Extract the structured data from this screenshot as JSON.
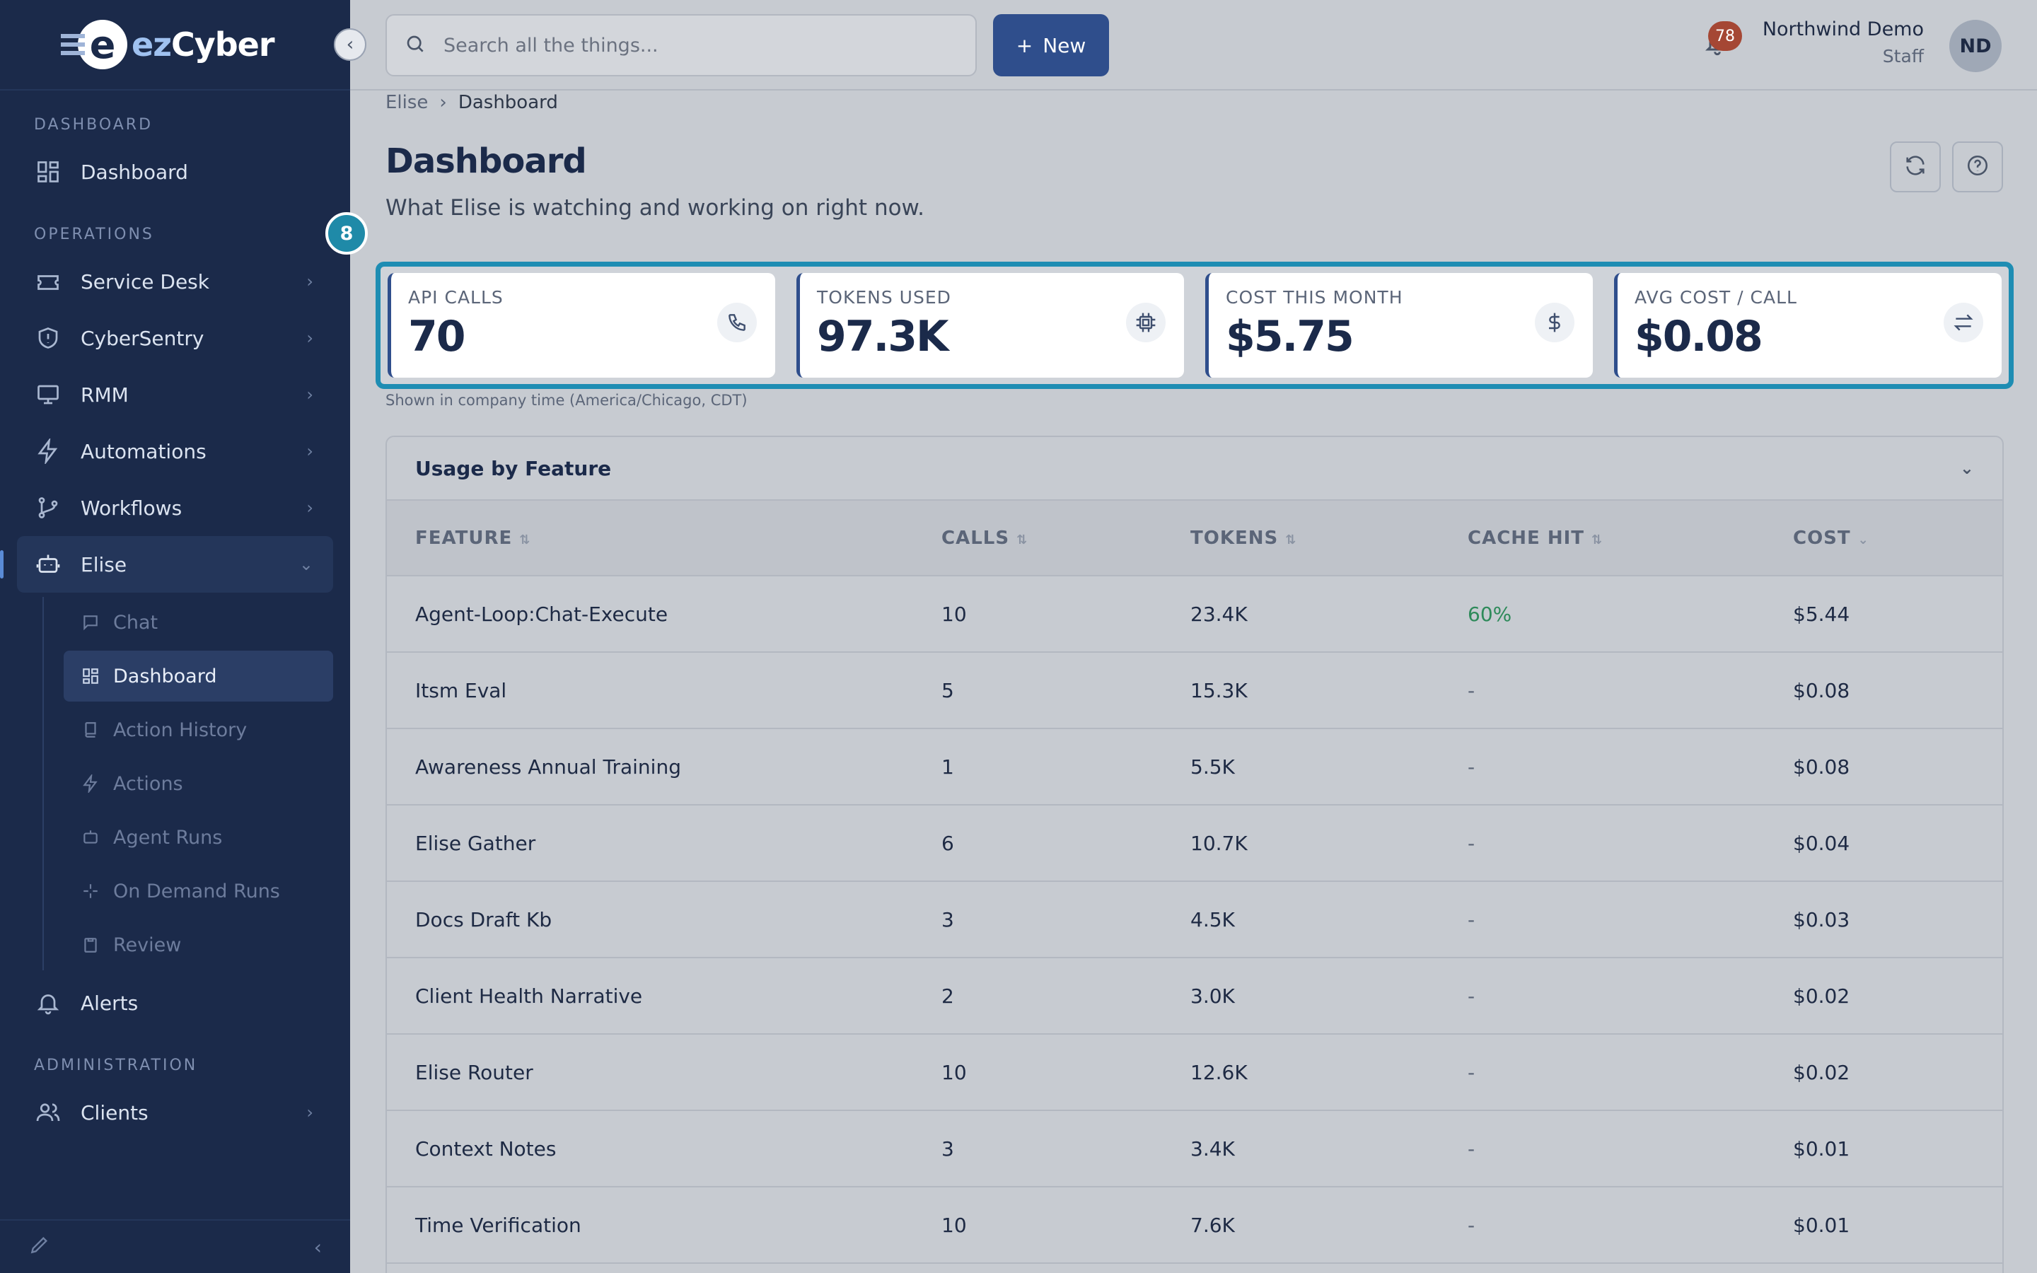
{
  "brand": {
    "logo_e": "e",
    "logo_ez": "ez",
    "logo_cyber": "Cyber"
  },
  "sidebar": {
    "sections": {
      "dashboard": "DASHBOARD",
      "operations": "OPERATIONS",
      "administration": "ADMINISTRATION"
    },
    "items": {
      "dashboard": "Dashboard",
      "service_desk": "Service Desk",
      "cybersentry": "CyberSentry",
      "rmm": "RMM",
      "automations": "Automations",
      "workflows": "Workflows",
      "elise": "Elise",
      "alerts": "Alerts",
      "clients": "Clients"
    },
    "elise_sub": {
      "chat": "Chat",
      "dashboard": "Dashboard",
      "action_history": "Action History",
      "actions": "Actions",
      "agent_runs": "Agent Runs",
      "on_demand_runs": "On Demand Runs",
      "review": "Review"
    }
  },
  "topbar": {
    "search_placeholder": "Search all the things...",
    "new_label": "New",
    "notification_count": "78",
    "user_name": "Northwind Demo",
    "user_role": "Staff",
    "avatar_initials": "ND"
  },
  "breadcrumb": {
    "root": "Elise",
    "current": "Dashboard"
  },
  "page": {
    "title": "Dashboard",
    "subtitle": "What Elise is watching and working on right now.",
    "step_number": "8",
    "tz_note": "Shown in company time (America/Chicago, CDT)"
  },
  "stats": [
    {
      "label": "API CALLS",
      "value": "70",
      "icon": "phone-icon"
    },
    {
      "label": "TOKENS USED",
      "value": "97.3K",
      "icon": "chip-icon"
    },
    {
      "label": "COST THIS MONTH",
      "value": "$5.75",
      "icon": "dollar-icon"
    },
    {
      "label": "AVG COST / CALL",
      "value": "$0.08",
      "icon": "swap-icon"
    }
  ],
  "usage": {
    "title": "Usage by Feature",
    "columns": [
      "FEATURE",
      "CALLS",
      "TOKENS",
      "CACHE HIT",
      "COST"
    ],
    "rows": [
      [
        "Agent-Loop:Chat-Execute",
        "10",
        "23.4K",
        "60%",
        "$5.44"
      ],
      [
        "Itsm Eval",
        "5",
        "15.3K",
        "-",
        "$0.08"
      ],
      [
        "Awareness Annual Training",
        "1",
        "5.5K",
        "-",
        "$0.08"
      ],
      [
        "Elise Gather",
        "6",
        "10.7K",
        "-",
        "$0.04"
      ],
      [
        "Docs Draft Kb",
        "3",
        "4.5K",
        "-",
        "$0.03"
      ],
      [
        "Client Health Narrative",
        "2",
        "3.0K",
        "-",
        "$0.02"
      ],
      [
        "Elise Router",
        "10",
        "12.6K",
        "-",
        "$0.02"
      ],
      [
        "Context Notes",
        "3",
        "3.4K",
        "-",
        "$0.01"
      ],
      [
        "Time Verification",
        "10",
        "7.6K",
        "-",
        "$0.01"
      ]
    ]
  },
  "colors": {
    "sidebar_bg": "#1b2a4a",
    "accent": "#2f4e8c",
    "highlight": "#1e8db3",
    "cache_good": "#2e8a5a"
  }
}
